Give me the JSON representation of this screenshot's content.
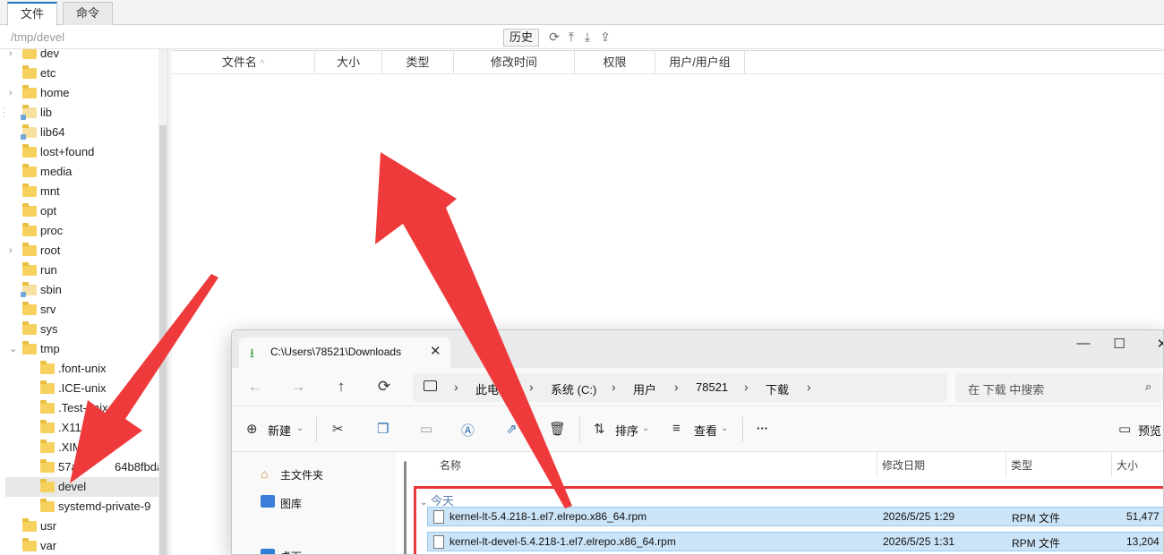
{
  "tabs": [
    {
      "label": "文件"
    },
    {
      "label": "命令"
    }
  ],
  "pathbar": {
    "path": "/tmp/devel",
    "history_label": "历史"
  },
  "tree": [
    {
      "label": "dev",
      "expander": true
    },
    {
      "label": "etc",
      "expander": false
    },
    {
      "label": "home",
      "expander": true
    },
    {
      "label": "lib",
      "expander": false,
      "link": true
    },
    {
      "label": "lib64",
      "expander": false,
      "link": true
    },
    {
      "label": "lost+found",
      "expander": false
    },
    {
      "label": "media",
      "expander": false
    },
    {
      "label": "mnt",
      "expander": false
    },
    {
      "label": "opt",
      "expander": false
    },
    {
      "label": "proc",
      "expander": false
    },
    {
      "label": "root",
      "expander": true
    },
    {
      "label": "run",
      "expander": false
    },
    {
      "label": "sbin",
      "expander": false,
      "link": true
    },
    {
      "label": "srv",
      "expander": false
    },
    {
      "label": "sys",
      "expander": false
    },
    {
      "label": "tmp",
      "expander": true,
      "open": true
    },
    {
      "label": ".font-unix",
      "child": true
    },
    {
      "label": ".ICE-unix",
      "child": true
    },
    {
      "label": ".Test-unix",
      "child": true
    },
    {
      "label": ".X11",
      "child": true
    },
    {
      "label": ".XIM",
      "child": true
    },
    {
      "label": "57a",
      "child": true,
      "tail": "64b8fbda"
    },
    {
      "label": "devel",
      "child": true,
      "selected": true
    },
    {
      "label": "systemd-private-9",
      "child": true
    },
    {
      "label": "usr",
      "expander": false
    },
    {
      "label": "var",
      "expander": false
    }
  ],
  "file_table": {
    "columns": [
      "文件名",
      "大小",
      "类型",
      "修改时间",
      "权限",
      "用户/用户组"
    ]
  },
  "explorer": {
    "tab_title": "C:\\Users\\78521\\Downloads",
    "breadcrumb": [
      "此电",
      "系统 (C:)",
      "用户",
      "78521",
      "下载"
    ],
    "search_placeholder": "在 下载 中搜索",
    "toolbar": {
      "new": "新建",
      "sort": "排序",
      "view": "查看",
      "more": "···",
      "preview": "预览"
    },
    "nav_pane": [
      "主文件夹",
      "图库",
      "桌面"
    ],
    "columns": [
      "名称",
      "修改日期",
      "类型",
      "大小"
    ],
    "group": "今天",
    "files": [
      {
        "name": "kernel-lt-5.4.218-1.el7.elrepo.x86_64.rpm",
        "date": "2026/5/25 1:29",
        "type": "RPM 文件",
        "size": "51,477"
      },
      {
        "name": "kernel-lt-devel-5.4.218-1.el7.elrepo.x86_64.rpm",
        "date": "2026/5/25 1:31",
        "type": "RPM 文件",
        "size": "13,204"
      }
    ]
  },
  "colors": {
    "accent": "#1a73c8",
    "arrow": "#ef3a3c",
    "highlight_row": "#cce4f7",
    "folder": "#f7d15e"
  }
}
